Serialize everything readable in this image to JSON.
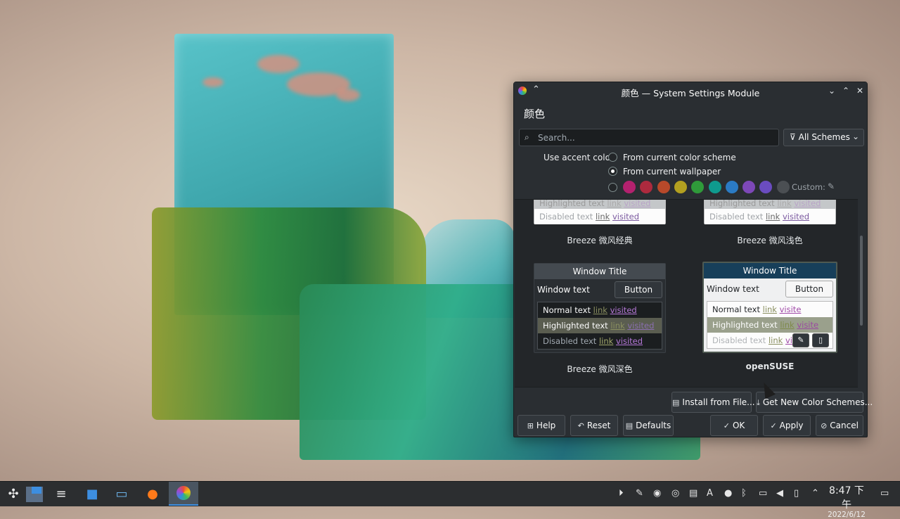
{
  "window": {
    "title": "颜色 — System Settings Module",
    "keep_above_glyph": "⌃",
    "minimize_glyph": "⌄",
    "maximize_glyph": "⌃",
    "close_glyph": "✕"
  },
  "header": {
    "title": "颜色"
  },
  "search": {
    "placeholder": "Search..."
  },
  "filter": {
    "label": "All Schemes"
  },
  "accent": {
    "label": "Use accent color:",
    "option_scheme": "From current color scheme",
    "option_wallpaper": "From current wallpaper",
    "selected": "From current wallpaper",
    "custom_label": "Custom:",
    "swatch_colors": [
      "#b3216e",
      "#ad2a3e",
      "#b8492a",
      "#b3a020",
      "#2f9a3a",
      "#0f9a8e",
      "#2b7bc4",
      "#7d48b8",
      "#6a4cc0",
      "#4b4f53"
    ]
  },
  "schemes": {
    "top_left": {
      "label": "Breeze 微风经典",
      "highlighted": "Highlighted text",
      "disabled": "Disabled text",
      "link": "link",
      "visited": "visited"
    },
    "top_right": {
      "label": "Breeze 微风浅色",
      "highlighted": "Highlighted text",
      "disabled": "Disabled text",
      "link": "link",
      "visited": "visited"
    },
    "dark": {
      "label": "Breeze 微风深色",
      "window_title": "Window Title",
      "window_text": "Window text",
      "button": "Button",
      "normal": "Normal text",
      "highlighted": "Highlighted text",
      "disabled": "Disabled text",
      "link": "link",
      "visited": "visited"
    },
    "opensuse": {
      "label": "openSUSE",
      "window_title": "Window Title",
      "window_text": "Window text",
      "button": "Button",
      "normal": "Normal text",
      "highlighted": "Highlighted text",
      "disabled": "Disabled text",
      "link": "link",
      "visited": "visite"
    }
  },
  "buttons": {
    "install": "Install from File...",
    "get_new": "Get New Color Schemes...",
    "help": "Help",
    "reset": "Reset",
    "defaults": "Defaults",
    "ok": "OK",
    "apply": "Apply",
    "cancel": "Cancel"
  },
  "taskbar": {
    "clock_time": "8:47 下午",
    "clock_date": "2022/6/12"
  }
}
